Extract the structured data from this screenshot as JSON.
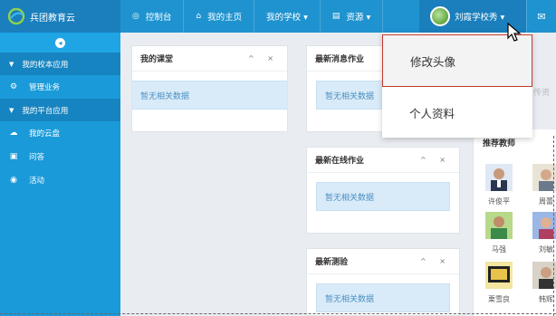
{
  "brand": {
    "name": "兵团教育云"
  },
  "nav": {
    "items": [
      {
        "icon": "dashboard-icon",
        "label": "控制台",
        "glyph": "◎"
      },
      {
        "icon": "home-icon",
        "label": "我的主页",
        "glyph": "⌂"
      },
      {
        "icon": "",
        "label": "我的学校 ▾",
        "glyph": ""
      },
      {
        "icon": "book-icon",
        "label": "资源 ▾",
        "glyph": "▤"
      }
    ],
    "user_name": "刘霞学校秀 ▾",
    "mail_glyph": "✉"
  },
  "sidebar": {
    "collapse_glyph": "◂",
    "groups": [
      {
        "label": "我的校本应用",
        "items": [
          {
            "label": "管理业务",
            "glyph": "⚙"
          }
        ]
      },
      {
        "label": "我的平台应用",
        "items": [
          {
            "label": "我的云盘",
            "glyph": "☁"
          },
          {
            "label": "问答",
            "glyph": "▣"
          },
          {
            "label": "活动",
            "glyph": "◉"
          }
        ]
      }
    ]
  },
  "panels": {
    "my_class": {
      "title": "我的课堂",
      "tools": "^ ×",
      "empty": "暂无相关数据"
    },
    "latest_homework": {
      "title": "最新消息作业",
      "tools": "^ ×",
      "empty": "暂无相关数据"
    },
    "online_homework": {
      "title": "最新在线作业",
      "tools": "^ ×",
      "empty": "暂无相关数据"
    },
    "latest_test": {
      "title": "最新测验",
      "tools": "^ ×",
      "empty": "暂无相关数据"
    }
  },
  "right": {
    "partial_text": "传资",
    "recommend_title": "推荐教师",
    "teachers": [
      {
        "name": "许俊平"
      },
      {
        "name": "周蕾"
      },
      {
        "name": "马强"
      },
      {
        "name": "刘敏"
      },
      {
        "name": "栗雪良"
      },
      {
        "name": "韩辉"
      }
    ]
  },
  "dropdown": {
    "items": [
      {
        "label": "修改头像"
      },
      {
        "label": "个人资料"
      }
    ]
  }
}
